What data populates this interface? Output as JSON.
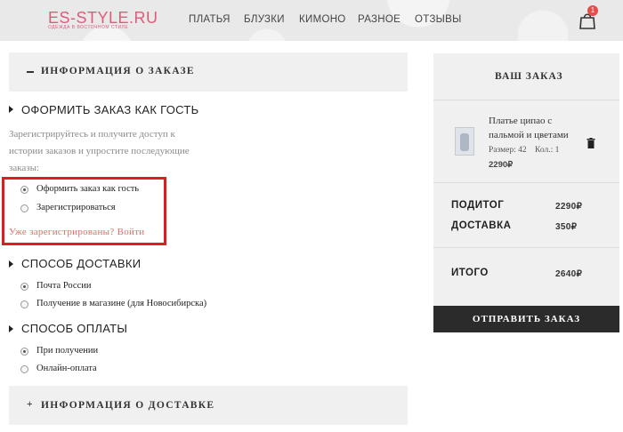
{
  "header": {
    "logo": "ES-STYLE.RU",
    "logo_sub": "ОДЕЖДА В ВОСТОЧНОМ СТИЛЕ",
    "nav": [
      "ПЛАТЬЯ",
      "БЛУЗКИ",
      "КИМОНО",
      "РАЗНОЕ",
      "ОТЗЫВЫ"
    ],
    "cart_count": "1"
  },
  "checkout": {
    "order_info_title": "ИНФОРМАЦИЯ О ЗАКАЗЕ",
    "order_info_icon": "minus",
    "guest_section": "ОФОРМИТЬ ЗАКАЗ КАК ГОСТЬ",
    "guest_hint": [
      "Зарегистрируйтесь и получите доступ к",
      "истории заказов и упростите последующие",
      "заказы:"
    ],
    "account_options": [
      {
        "label": "Оформить заказ как гость",
        "checked": true
      },
      {
        "label": "Зарегистрироваться",
        "checked": false
      }
    ],
    "login_link": "Уже зарегистрированы? Войти",
    "delivery_section": "СПОСОБ ДОСТАВКИ",
    "delivery_options": [
      {
        "label": "Почта России",
        "checked": true
      },
      {
        "label": "Получение в магазине (для Новосибирска)",
        "checked": false
      }
    ],
    "payment_section": "СПОСОБ ОПЛАТЫ",
    "payment_options": [
      {
        "label": "При получении",
        "checked": true
      },
      {
        "label": "Онлайн-оплата",
        "checked": false
      }
    ],
    "delivery_info_title": "ИНФОРМАЦИЯ О ДОСТАВКЕ",
    "delivery_info_icon": "+"
  },
  "order": {
    "title": "ВАШ ЗАКАЗ",
    "item": {
      "name_lines": [
        "Платье ципао с",
        "пальмой и цветами"
      ],
      "size": "Размер: 42",
      "qty": "Кол.: 1",
      "price": "2290₽"
    },
    "subtotal_label": "ПОДИТОГ",
    "subtotal_value": "2290₽",
    "shipping_label": "ДОСТАВКА",
    "shipping_value": "350₽",
    "total_label": "ИТОГО",
    "total_value": "2640₽",
    "submit": "ОТПРАВИТЬ ЗАКАЗ"
  },
  "colors": {
    "accent": "#e05b7a",
    "highlight": "#e01b24",
    "button": "#2b2b2b"
  }
}
